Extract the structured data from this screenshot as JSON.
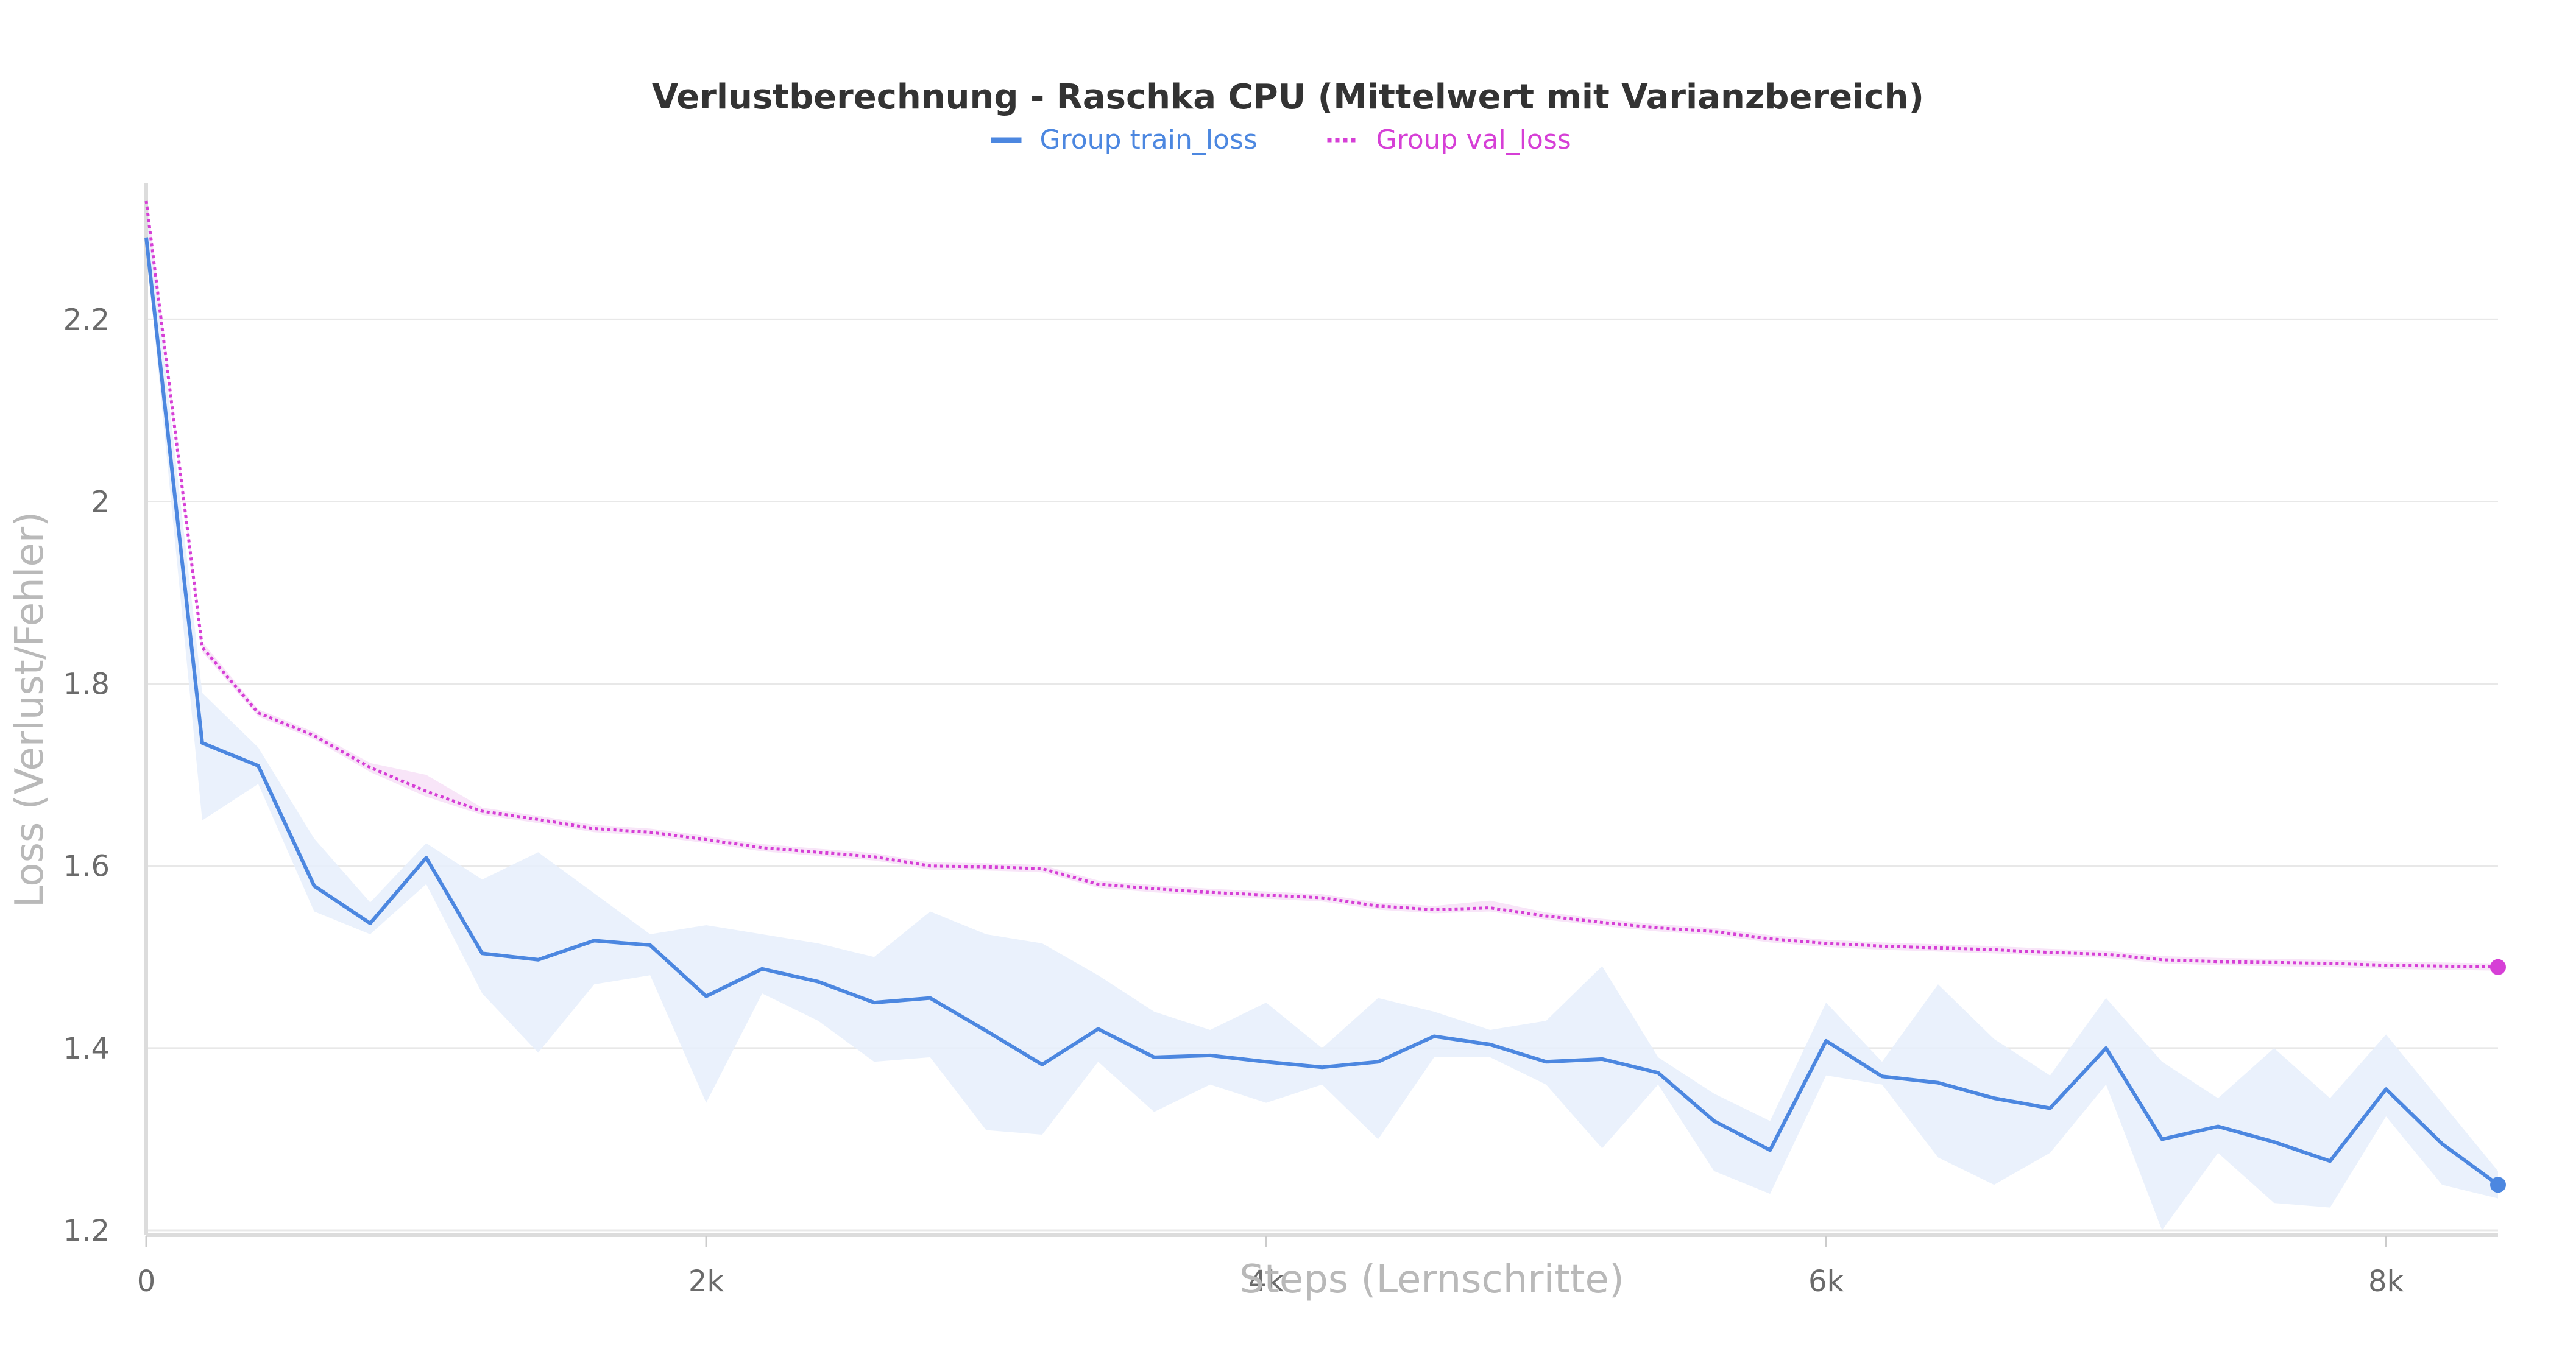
{
  "chart_data": {
    "type": "line",
    "title": "Verlustberechnung - Raschka CPU (Mittelwert mit Varianzbereich)",
    "xlabel": "Steps (Lernschritte)",
    "ylabel": "Loss (Verlust/Fehler)",
    "xlim": [
      0,
      8400
    ],
    "ylim": [
      1.2,
      2.35
    ],
    "x_ticks": [
      {
        "value": 0,
        "label": "0"
      },
      {
        "value": 2000,
        "label": "2k"
      },
      {
        "value": 4000,
        "label": "4k"
      },
      {
        "value": 6000,
        "label": "6k"
      },
      {
        "value": 8000,
        "label": "8k"
      }
    ],
    "y_ticks": [
      {
        "value": 1.2,
        "label": "1.2"
      },
      {
        "value": 1.4,
        "label": "1.4"
      },
      {
        "value": 1.6,
        "label": "1.6"
      },
      {
        "value": 1.8,
        "label": "1.8"
      },
      {
        "value": 2.0,
        "label": "2"
      },
      {
        "value": 2.2,
        "label": "2.2"
      }
    ],
    "grid": true,
    "legend_position": "top-center",
    "x": [
      0,
      200,
      400,
      600,
      800,
      1000,
      1200,
      1400,
      1600,
      1800,
      2000,
      2200,
      2400,
      2600,
      2800,
      3000,
      3200,
      3400,
      3600,
      3800,
      4000,
      4200,
      4400,
      4600,
      4800,
      5000,
      5200,
      5400,
      5600,
      5800,
      6000,
      6200,
      6400,
      6600,
      6800,
      7000,
      7200,
      7400,
      7600,
      7800,
      8000,
      8200,
      8400
    ],
    "series": [
      {
        "name": "Group train_loss",
        "color": "#4c87e0",
        "band_color": "#e6effb",
        "style": "solid",
        "values": [
          2.29,
          1.735,
          1.71,
          1.578,
          1.537,
          1.609,
          1.504,
          1.497,
          1.518,
          1.513,
          1.457,
          1.487,
          1.473,
          1.45,
          1.455,
          1.419,
          1.382,
          1.421,
          1.39,
          1.392,
          1.385,
          1.379,
          1.385,
          1.413,
          1.404,
          1.385,
          1.388,
          1.373,
          1.32,
          1.288,
          1.408,
          1.369,
          1.362,
          1.345,
          1.334,
          1.4,
          1.3,
          1.314,
          1.297,
          1.276,
          1.355,
          1.295,
          1.25
        ],
        "band_low": [
          2.28,
          1.65,
          1.69,
          1.55,
          1.525,
          1.58,
          1.46,
          1.395,
          1.47,
          1.48,
          1.34,
          1.46,
          1.43,
          1.385,
          1.39,
          1.31,
          1.305,
          1.385,
          1.33,
          1.36,
          1.34,
          1.36,
          1.3,
          1.39,
          1.39,
          1.36,
          1.29,
          1.36,
          1.265,
          1.24,
          1.37,
          1.36,
          1.28,
          1.25,
          1.285,
          1.36,
          1.2,
          1.285,
          1.23,
          1.225,
          1.325,
          1.25,
          1.235
        ],
        "band_high": [
          2.33,
          1.79,
          1.73,
          1.63,
          1.56,
          1.625,
          1.585,
          1.615,
          1.57,
          1.525,
          1.535,
          1.525,
          1.515,
          1.5,
          1.55,
          1.525,
          1.515,
          1.48,
          1.44,
          1.42,
          1.45,
          1.4,
          1.455,
          1.44,
          1.42,
          1.43,
          1.49,
          1.39,
          1.35,
          1.32,
          1.45,
          1.385,
          1.47,
          1.41,
          1.37,
          1.455,
          1.385,
          1.345,
          1.4,
          1.345,
          1.415,
          1.34,
          1.265
        ]
      },
      {
        "name": "Group val_loss",
        "color": "#d63fd6",
        "band_color": "#f7e1f7",
        "style": "dotted",
        "values": [
          2.33,
          1.84,
          1.768,
          1.743,
          1.708,
          1.682,
          1.66,
          1.651,
          1.641,
          1.637,
          1.629,
          1.62,
          1.615,
          1.61,
          1.6,
          1.599,
          1.597,
          1.58,
          1.575,
          1.571,
          1.568,
          1.565,
          1.556,
          1.552,
          1.554,
          1.545,
          1.538,
          1.532,
          1.528,
          1.52,
          1.515,
          1.512,
          1.51,
          1.508,
          1.505,
          1.503,
          1.497,
          1.495,
          1.494,
          1.493,
          1.491,
          1.49,
          1.489
        ],
        "band_low": [
          2.32,
          1.835,
          1.764,
          1.739,
          1.703,
          1.676,
          1.656,
          1.647,
          1.637,
          1.633,
          1.625,
          1.616,
          1.611,
          1.606,
          1.596,
          1.595,
          1.593,
          1.576,
          1.571,
          1.567,
          1.564,
          1.561,
          1.552,
          1.548,
          1.55,
          1.541,
          1.534,
          1.528,
          1.524,
          1.516,
          1.511,
          1.508,
          1.506,
          1.504,
          1.501,
          1.499,
          1.493,
          1.491,
          1.49,
          1.489,
          1.487,
          1.486,
          1.485
        ],
        "band_high": [
          2.34,
          1.846,
          1.772,
          1.747,
          1.713,
          1.7,
          1.664,
          1.655,
          1.645,
          1.641,
          1.633,
          1.624,
          1.619,
          1.614,
          1.604,
          1.603,
          1.601,
          1.584,
          1.579,
          1.575,
          1.572,
          1.569,
          1.56,
          1.556,
          1.562,
          1.549,
          1.542,
          1.536,
          1.532,
          1.524,
          1.519,
          1.516,
          1.514,
          1.512,
          1.509,
          1.507,
          1.501,
          1.499,
          1.498,
          1.497,
          1.495,
          1.494,
          1.493
        ]
      }
    ]
  }
}
